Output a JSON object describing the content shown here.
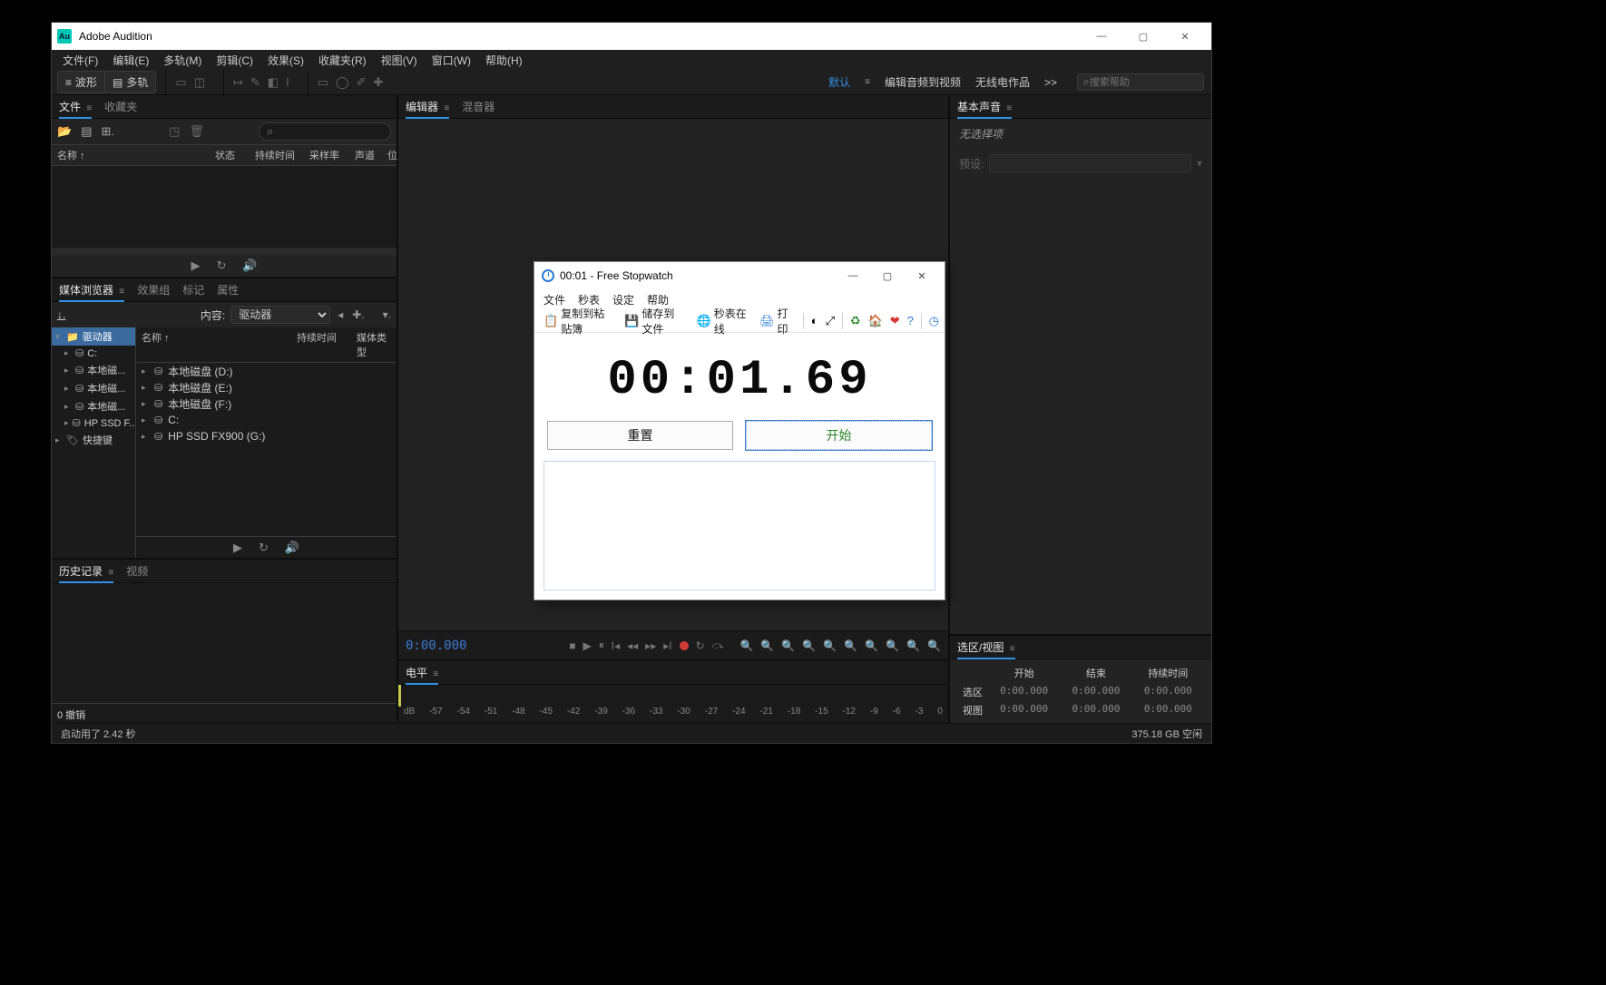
{
  "audition": {
    "titlebar": {
      "title": "Adobe Audition"
    },
    "menubar": [
      "文件(F)",
      "编辑(E)",
      "多轨(M)",
      "剪辑(C)",
      "效果(S)",
      "收藏夹(R)",
      "视图(V)",
      "窗口(W)",
      "帮助(H)"
    ],
    "toolbar": {
      "mode_waveform": "波形",
      "mode_multitrack": "多轨",
      "ws_default": "默认",
      "ws_audio_to_video": "编辑音频到视频",
      "ws_radio": "无线电作品",
      "ws_more": ">>",
      "search_placeholder": "搜索帮助"
    },
    "left": {
      "files": {
        "tab_files": "文件",
        "tab_favorites": "收藏夹",
        "header": {
          "name": "名称 ↑",
          "status": "状态",
          "duration": "持续时间",
          "samplerate": "采样率",
          "channels": "声道",
          "bit": "位"
        }
      },
      "media": {
        "tab_media": "媒体浏览器",
        "tab_effects": "效果组",
        "tab_markers": "标记",
        "tab_properties": "属性",
        "content_label": "内容:",
        "content_select": "驱动器",
        "tree": [
          {
            "label": "驱动器",
            "selected": true,
            "expandable": true,
            "expanded": true,
            "icon": "folder",
            "depth": 0
          },
          {
            "label": "C:",
            "selected": false,
            "expandable": true,
            "expanded": false,
            "icon": "drive",
            "depth": 1
          },
          {
            "label": "本地磁...",
            "selected": false,
            "expandable": true,
            "expanded": false,
            "icon": "drive",
            "depth": 1
          },
          {
            "label": "本地磁...",
            "selected": false,
            "expandable": true,
            "expanded": false,
            "icon": "drive",
            "depth": 1
          },
          {
            "label": "本地磁...",
            "selected": false,
            "expandable": true,
            "expanded": false,
            "icon": "drive",
            "depth": 1
          },
          {
            "label": "HP SSD F...",
            "selected": false,
            "expandable": true,
            "expanded": false,
            "icon": "drive",
            "depth": 1
          },
          {
            "label": "快捷键",
            "selected": false,
            "expandable": true,
            "expanded": false,
            "icon": "tag",
            "depth": 0
          }
        ],
        "header": {
          "name": "名称 ↑",
          "duration": "持续时间",
          "type": "媒体类型"
        },
        "list": [
          {
            "label": "本地磁盘 (D:)"
          },
          {
            "label": "本地磁盘 (E:)"
          },
          {
            "label": "本地磁盘 (F:)"
          },
          {
            "label": "C:"
          },
          {
            "label": "HP SSD FX900 (G:)"
          }
        ]
      },
      "history": {
        "tab_history": "历史记录",
        "tab_video": "视频",
        "footer": "0 撤销"
      }
    },
    "center": {
      "tab_editor": "编辑器",
      "tab_mixer": "混音器",
      "timecode": "0:00.000",
      "levels_tab": "电平",
      "db_scale": [
        "dB",
        "-57",
        "-54",
        "-51",
        "-48",
        "-45",
        "-42",
        "-39",
        "-36",
        "-33",
        "-30",
        "-27",
        "-24",
        "-21",
        "-18",
        "-15",
        "-12",
        "-9",
        "-6",
        "-3",
        "0"
      ]
    },
    "right": {
      "tab_essential_sound": "基本声音",
      "no_selection": "无选择项",
      "preset_label": "预设:",
      "selview_tab": "选区/视图",
      "selview": {
        "col_start": "开始",
        "col_end": "结束",
        "col_duration": "持续时间",
        "row_sel": "选区",
        "row_view": "视图",
        "zero": "0:00.000"
      }
    },
    "statusbar": {
      "left_text": "启动用了 2.42 秒",
      "right_text": "375.18 GB 空闲"
    }
  },
  "stopwatch": {
    "title": "00:01 - Free Stopwatch",
    "menubar": [
      "文件",
      "秒表",
      "设定",
      "帮助"
    ],
    "toolbar": {
      "copy": "复制到粘贴簿",
      "save": "储存到文件",
      "online": "秒表在线",
      "print": "打印"
    },
    "display": "00:01.69",
    "btn_reset": "重置",
    "btn_start": "开始"
  }
}
